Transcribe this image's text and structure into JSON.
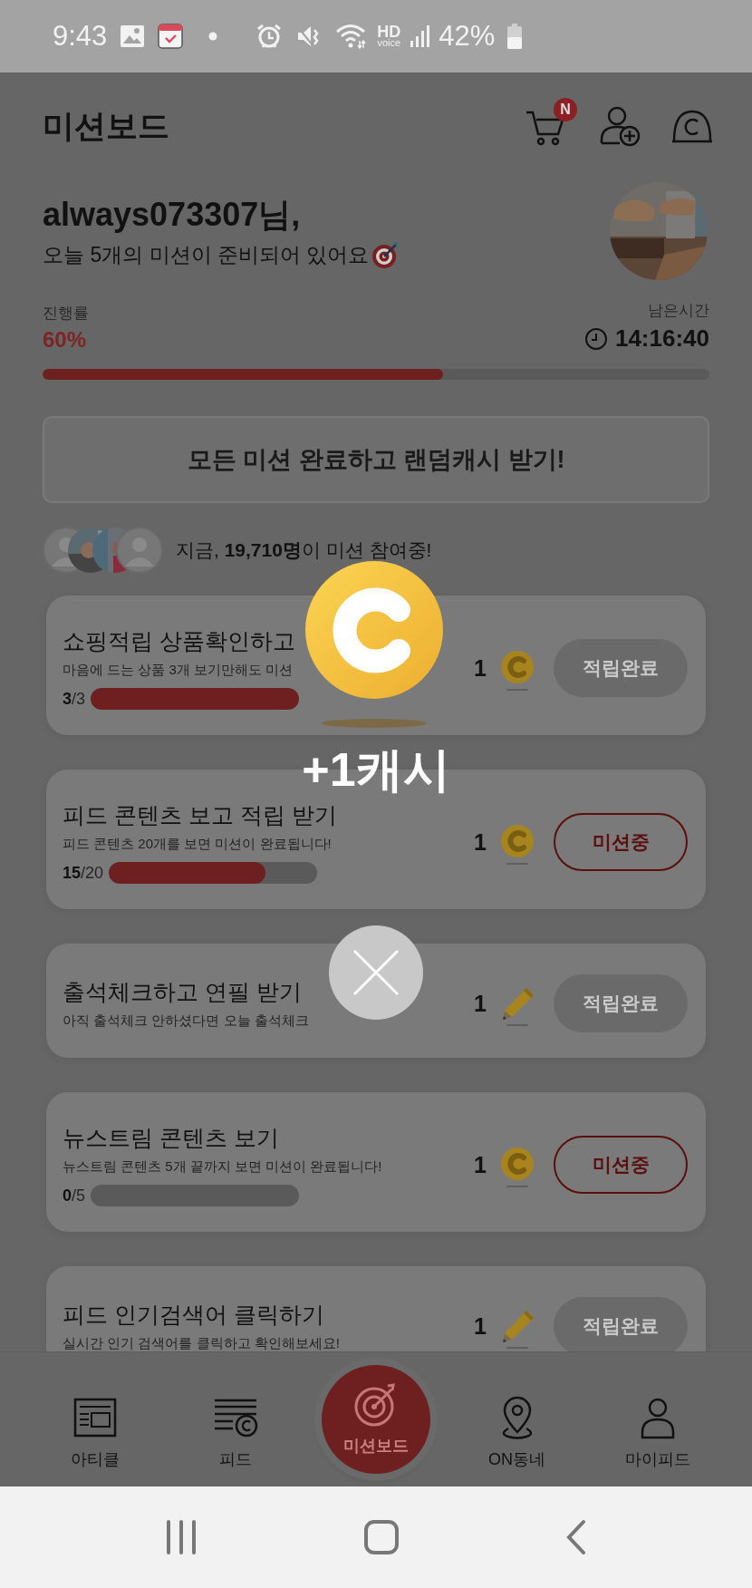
{
  "status_bar": {
    "time": "9:43",
    "hd": "HD",
    "voice": "voice",
    "battery_text": "42%"
  },
  "header": {
    "title": "미션보드",
    "cart_badge": "N"
  },
  "greeting": {
    "name": "always073307님,",
    "message": "오늘 5개의 미션이 준비되어 있어요"
  },
  "progress": {
    "label": "진행률",
    "value": "60%",
    "level": 0.6,
    "time_label": "남은시간",
    "time": "14:16:40"
  },
  "bonus_button": {
    "label": "모든 미션 완료하고 랜덤캐시 받기!"
  },
  "participants": {
    "text": "지금, **19,710명**이 미션 참여중!"
  },
  "missions": [
    {
      "title": "쇼핑적립 상품확인하고",
      "subtitle": "마음에 드는 상품 3개 보기만해도 미션",
      "progress": {
        "text": "**3**/3",
        "level": 1
      },
      "reward": {
        "amount": "1",
        "kind": "coin"
      },
      "button": {
        "label": "적립완료",
        "kind": "done"
      }
    },
    {
      "title": "피드 콘텐츠 보고 적립 받기",
      "subtitle": "피드 콘텐츠 20개를 보면 미션이 완료됩니다!",
      "progress": {
        "text": "**15**/20",
        "level": 0.75
      },
      "reward": {
        "amount": "1",
        "kind": "coin"
      },
      "button": {
        "label": "미션중",
        "kind": "active"
      }
    },
    {
      "title": "출석체크하고 연필 받기",
      "subtitle": "아직 출석체크 안하셨다면 오늘 출석체크",
      "reward": {
        "amount": "1",
        "kind": "pencil"
      },
      "button": {
        "label": "적립완료",
        "kind": "done"
      }
    },
    {
      "title": "뉴스트림 콘텐츠 보기",
      "subtitle": "뉴스트림 콘텐츠 5개 끝까지 보면 미션이 완료됩니다!",
      "progress": {
        "text": "**0**/5",
        "level": 0
      },
      "reward": {
        "amount": "1",
        "kind": "coin"
      },
      "button": {
        "label": "미션중",
        "kind": "active"
      }
    },
    {
      "title": "피드 인기검색어 클릭하기",
      "subtitle": "실시간 인기 검색어를 클릭하고 확인해보세요!",
      "reward": {
        "amount": "1",
        "kind": "pencil"
      },
      "button": {
        "label": "적립완료",
        "kind": "done"
      }
    }
  ],
  "popup": {
    "reward_text": "+1캐시"
  },
  "bottom_nav": [
    {
      "label": "아티클",
      "selected": false
    },
    {
      "label": "피드",
      "selected": false
    },
    {
      "label": "미션보드",
      "selected": true
    },
    {
      "label": "ON동네",
      "selected": false
    },
    {
      "label": "마이피드",
      "selected": false
    }
  ]
}
